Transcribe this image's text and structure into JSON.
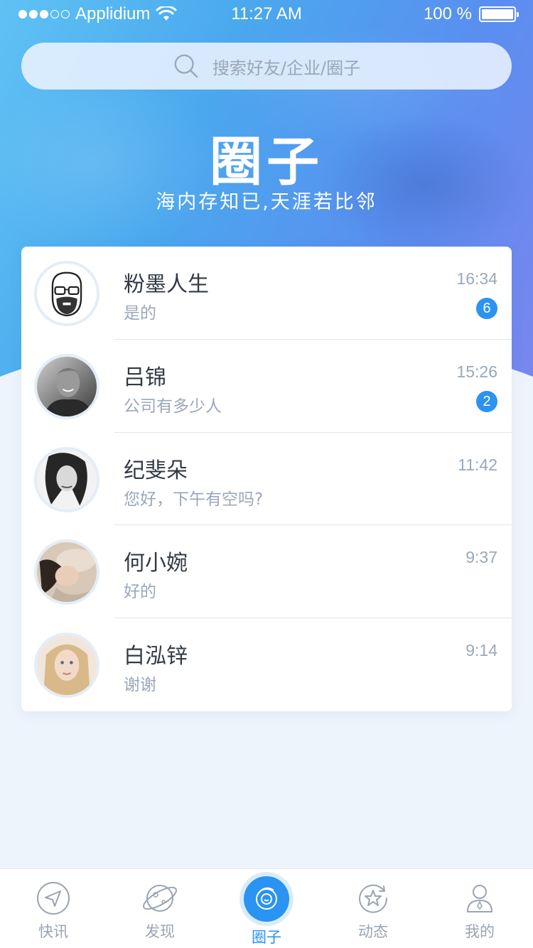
{
  "status_bar": {
    "carrier": "Applidium",
    "time": "11:27 AM",
    "battery": "100 %"
  },
  "search": {
    "placeholder": "搜索好友/企业/圈子"
  },
  "hero": {
    "title": "圈子",
    "subtitle": "海内存知已,天涯若比邻"
  },
  "conversations": [
    {
      "name": "粉墨人生",
      "message": "是的",
      "time": "16:34",
      "badge": "6"
    },
    {
      "name": "吕锦",
      "message": "公司有多少人",
      "time": "15:26",
      "badge": "2"
    },
    {
      "name": "纪斐朵",
      "message": "您好，下午有空吗?",
      "time": "11:42",
      "badge": ""
    },
    {
      "name": "何小婉",
      "message": "好的",
      "time": "9:37",
      "badge": ""
    },
    {
      "name": "白泓锌",
      "message": "谢谢",
      "time": "9:14",
      "badge": ""
    }
  ],
  "tabs": [
    {
      "label": "快讯",
      "icon": "send-icon"
    },
    {
      "label": "发现",
      "icon": "planet-icon"
    },
    {
      "label": "圈子",
      "icon": "circle-icon",
      "active": true
    },
    {
      "label": "动态",
      "icon": "star-icon"
    },
    {
      "label": "我的",
      "icon": "profile-icon"
    }
  ],
  "colors": {
    "accent": "#2b93f1",
    "hero_gradient_start": "#5fc2f4",
    "hero_gradient_end": "#7a86ee",
    "background": "#eef4fc"
  }
}
